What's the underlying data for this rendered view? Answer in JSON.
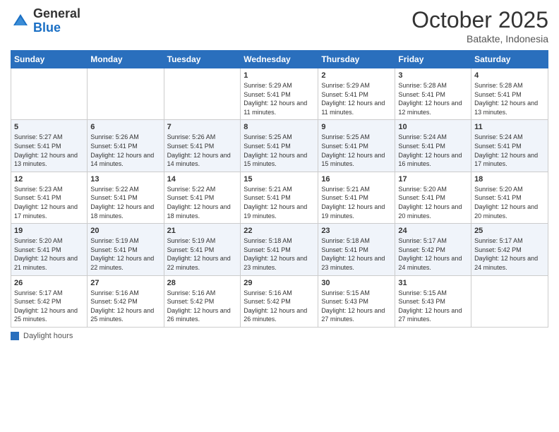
{
  "header": {
    "logo_general": "General",
    "logo_blue": "Blue",
    "month": "October 2025",
    "location": "Batakte, Indonesia"
  },
  "days_of_week": [
    "Sunday",
    "Monday",
    "Tuesday",
    "Wednesday",
    "Thursday",
    "Friday",
    "Saturday"
  ],
  "weeks": [
    [
      {
        "day": "",
        "info": ""
      },
      {
        "day": "",
        "info": ""
      },
      {
        "day": "",
        "info": ""
      },
      {
        "day": "1",
        "info": "Sunrise: 5:29 AM\nSunset: 5:41 PM\nDaylight: 12 hours and 11 minutes."
      },
      {
        "day": "2",
        "info": "Sunrise: 5:29 AM\nSunset: 5:41 PM\nDaylight: 12 hours and 11 minutes."
      },
      {
        "day": "3",
        "info": "Sunrise: 5:28 AM\nSunset: 5:41 PM\nDaylight: 12 hours and 12 minutes."
      },
      {
        "day": "4",
        "info": "Sunrise: 5:28 AM\nSunset: 5:41 PM\nDaylight: 12 hours and 13 minutes."
      }
    ],
    [
      {
        "day": "5",
        "info": "Sunrise: 5:27 AM\nSunset: 5:41 PM\nDaylight: 12 hours and 13 minutes."
      },
      {
        "day": "6",
        "info": "Sunrise: 5:26 AM\nSunset: 5:41 PM\nDaylight: 12 hours and 14 minutes."
      },
      {
        "day": "7",
        "info": "Sunrise: 5:26 AM\nSunset: 5:41 PM\nDaylight: 12 hours and 14 minutes."
      },
      {
        "day": "8",
        "info": "Sunrise: 5:25 AM\nSunset: 5:41 PM\nDaylight: 12 hours and 15 minutes."
      },
      {
        "day": "9",
        "info": "Sunrise: 5:25 AM\nSunset: 5:41 PM\nDaylight: 12 hours and 15 minutes."
      },
      {
        "day": "10",
        "info": "Sunrise: 5:24 AM\nSunset: 5:41 PM\nDaylight: 12 hours and 16 minutes."
      },
      {
        "day": "11",
        "info": "Sunrise: 5:24 AM\nSunset: 5:41 PM\nDaylight: 12 hours and 17 minutes."
      }
    ],
    [
      {
        "day": "12",
        "info": "Sunrise: 5:23 AM\nSunset: 5:41 PM\nDaylight: 12 hours and 17 minutes."
      },
      {
        "day": "13",
        "info": "Sunrise: 5:22 AM\nSunset: 5:41 PM\nDaylight: 12 hours and 18 minutes."
      },
      {
        "day": "14",
        "info": "Sunrise: 5:22 AM\nSunset: 5:41 PM\nDaylight: 12 hours and 18 minutes."
      },
      {
        "day": "15",
        "info": "Sunrise: 5:21 AM\nSunset: 5:41 PM\nDaylight: 12 hours and 19 minutes."
      },
      {
        "day": "16",
        "info": "Sunrise: 5:21 AM\nSunset: 5:41 PM\nDaylight: 12 hours and 19 minutes."
      },
      {
        "day": "17",
        "info": "Sunrise: 5:20 AM\nSunset: 5:41 PM\nDaylight: 12 hours and 20 minutes."
      },
      {
        "day": "18",
        "info": "Sunrise: 5:20 AM\nSunset: 5:41 PM\nDaylight: 12 hours and 20 minutes."
      }
    ],
    [
      {
        "day": "19",
        "info": "Sunrise: 5:20 AM\nSunset: 5:41 PM\nDaylight: 12 hours and 21 minutes."
      },
      {
        "day": "20",
        "info": "Sunrise: 5:19 AM\nSunset: 5:41 PM\nDaylight: 12 hours and 22 minutes."
      },
      {
        "day": "21",
        "info": "Sunrise: 5:19 AM\nSunset: 5:41 PM\nDaylight: 12 hours and 22 minutes."
      },
      {
        "day": "22",
        "info": "Sunrise: 5:18 AM\nSunset: 5:41 PM\nDaylight: 12 hours and 23 minutes."
      },
      {
        "day": "23",
        "info": "Sunrise: 5:18 AM\nSunset: 5:41 PM\nDaylight: 12 hours and 23 minutes."
      },
      {
        "day": "24",
        "info": "Sunrise: 5:17 AM\nSunset: 5:42 PM\nDaylight: 12 hours and 24 minutes."
      },
      {
        "day": "25",
        "info": "Sunrise: 5:17 AM\nSunset: 5:42 PM\nDaylight: 12 hours and 24 minutes."
      }
    ],
    [
      {
        "day": "26",
        "info": "Sunrise: 5:17 AM\nSunset: 5:42 PM\nDaylight: 12 hours and 25 minutes."
      },
      {
        "day": "27",
        "info": "Sunrise: 5:16 AM\nSunset: 5:42 PM\nDaylight: 12 hours and 25 minutes."
      },
      {
        "day": "28",
        "info": "Sunrise: 5:16 AM\nSunset: 5:42 PM\nDaylight: 12 hours and 26 minutes."
      },
      {
        "day": "29",
        "info": "Sunrise: 5:16 AM\nSunset: 5:42 PM\nDaylight: 12 hours and 26 minutes."
      },
      {
        "day": "30",
        "info": "Sunrise: 5:15 AM\nSunset: 5:43 PM\nDaylight: 12 hours and 27 minutes."
      },
      {
        "day": "31",
        "info": "Sunrise: 5:15 AM\nSunset: 5:43 PM\nDaylight: 12 hours and 27 minutes."
      },
      {
        "day": "",
        "info": ""
      }
    ]
  ],
  "footer": {
    "label": "Daylight hours"
  }
}
